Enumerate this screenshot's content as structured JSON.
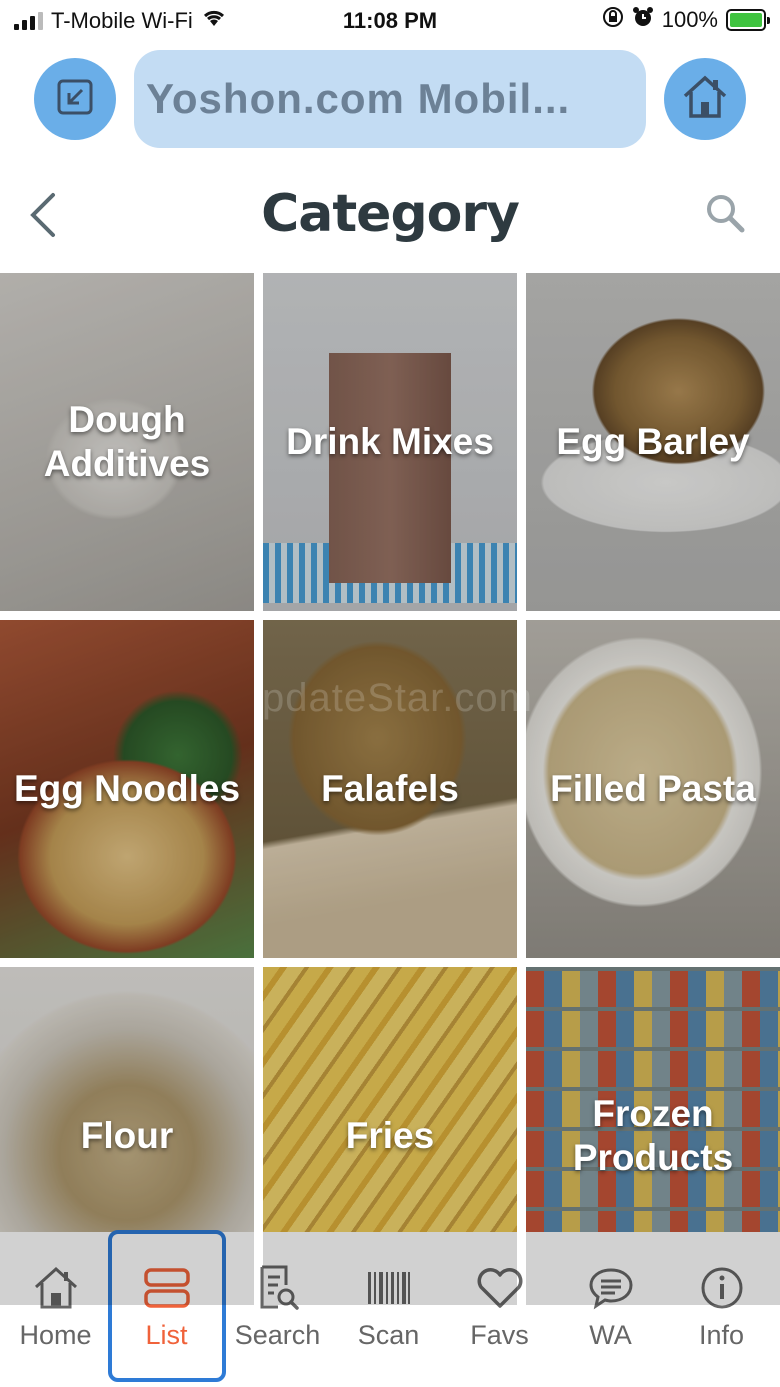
{
  "status_bar": {
    "carrier": "T-Mobile Wi-Fi",
    "time": "11:08 PM",
    "battery": "100%",
    "battery_level": 1.0
  },
  "browser": {
    "url_title": "Yoshon.com Mobil...",
    "minimize_icon": "minimize-arrow-icon",
    "home_icon": "house-icon"
  },
  "header": {
    "title": "Category",
    "back_icon": "chevron-left-icon",
    "search_icon": "search-icon"
  },
  "categories": [
    {
      "label": "Dough\nAdditives"
    },
    {
      "label": "Drink Mixes"
    },
    {
      "label": "Egg Barley"
    },
    {
      "label": "Egg Noodles"
    },
    {
      "label": "Falafels"
    },
    {
      "label": "Filled Pasta"
    },
    {
      "label": "Flour"
    },
    {
      "label": "Fries"
    },
    {
      "label": "Frozen\nProducts"
    }
  ],
  "watermark": "pdateStar.com",
  "nav": [
    {
      "label": "Home",
      "icon": "house-icon"
    },
    {
      "label": "List",
      "icon": "list-icon",
      "active": true
    },
    {
      "label": "Search",
      "icon": "document-search-icon"
    },
    {
      "label": "Scan",
      "icon": "barcode-icon"
    },
    {
      "label": "Favs",
      "icon": "heart-icon"
    },
    {
      "label": "WA",
      "icon": "chat-bubble-icon"
    },
    {
      "label": "Info",
      "icon": "info-icon"
    }
  ],
  "colors": {
    "accent_blue": "#6aaee8",
    "url_pill": "#c3dcf3",
    "active_nav": "#f0623a",
    "highlight_border": "#2e7bd6"
  }
}
